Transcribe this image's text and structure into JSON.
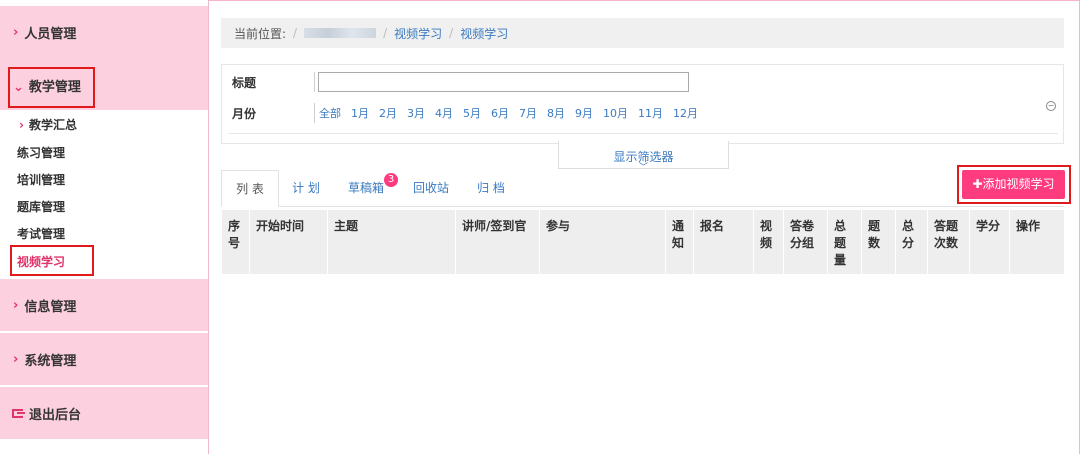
{
  "sidebar": {
    "groups": [
      {
        "label": "人员管理",
        "icon": "chevron-right-icon"
      },
      {
        "label": "信息管理",
        "icon": "chevron-right-icon"
      },
      {
        "label": "系统管理",
        "icon": "chevron-right-icon"
      }
    ],
    "open_group": {
      "label": "教学管理",
      "icon": "chevron-down-icon"
    },
    "sub_items": [
      "教学汇总",
      "练习管理",
      "培训管理",
      "题库管理",
      "考试管理",
      "视频学习"
    ],
    "exit": {
      "label": "退出后台",
      "icon": "sign-out-icon"
    }
  },
  "breadcrumb": {
    "prefix": "当前位置:",
    "sep": "/",
    "items": [
      "视频学习",
      "视频学习"
    ]
  },
  "filter": {
    "title_label": "标题",
    "title_value": "",
    "month_label": "月份",
    "months": [
      "全部",
      "1月",
      "2月",
      "3月",
      "4月",
      "5月",
      "6月",
      "7月",
      "8月",
      "9月",
      "10月",
      "11月",
      "12月"
    ],
    "toggle_label": "显示筛选器"
  },
  "tabs": [
    {
      "label": "列 表"
    },
    {
      "label": "计 划"
    },
    {
      "label": "草稿箱",
      "badge": "3"
    },
    {
      "label": "回收站"
    },
    {
      "label": "归 档"
    }
  ],
  "add_button": "添加视频学习",
  "table": {
    "headers": [
      "序号",
      "开始时间",
      "主题",
      "讲师/签到官",
      "参与",
      "通知",
      "报名",
      "视频",
      "答卷分组",
      "总题量",
      "题数",
      "总分",
      "答题次数",
      "学分",
      "操作"
    ]
  },
  "colors": {
    "accent": "#ff3b7f",
    "sidebar_bg": "#fcd0de",
    "link": "#3a7ac0",
    "highlight_box": "#e01a1a"
  }
}
